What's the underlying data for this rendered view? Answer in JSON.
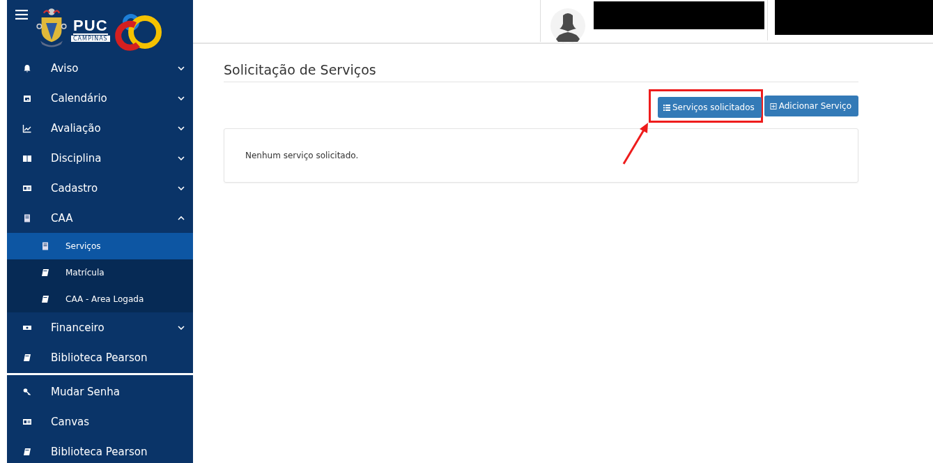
{
  "logo": {
    "name": "PUC",
    "subtitle": "CAMPINAS"
  },
  "menu": [
    {
      "label": "Aviso",
      "kind": "group",
      "expanded": false
    },
    {
      "label": "Calendário",
      "kind": "group",
      "expanded": false
    },
    {
      "label": "Avaliação",
      "kind": "group",
      "expanded": false
    },
    {
      "label": "Disciplina",
      "kind": "group",
      "expanded": false
    },
    {
      "label": "Cadastro",
      "kind": "group",
      "expanded": false
    },
    {
      "label": "CAA",
      "kind": "group",
      "expanded": true,
      "children": [
        {
          "label": "Serviços",
          "selected": true
        },
        {
          "label": "Matrícula",
          "selected": false
        },
        {
          "label": "CAA - Area Logada",
          "selected": false
        }
      ]
    },
    {
      "label": "Financeiro",
      "kind": "group",
      "expanded": false
    },
    {
      "label": "Biblioteca Pearson",
      "kind": "link"
    }
  ],
  "menu_bottom": [
    {
      "label": "Mudar Senha"
    },
    {
      "label": "Canvas"
    },
    {
      "label": "Biblioteca Pearson"
    }
  ],
  "page": {
    "title": "Solicitação de Serviços",
    "buttons": [
      {
        "label": "Serviços solicitados",
        "kind": "list",
        "highlighted": true
      },
      {
        "label": "Adicionar Serviço",
        "kind": "add",
        "highlighted": false
      }
    ],
    "empty_message": "Nenhum serviço solicitado."
  }
}
